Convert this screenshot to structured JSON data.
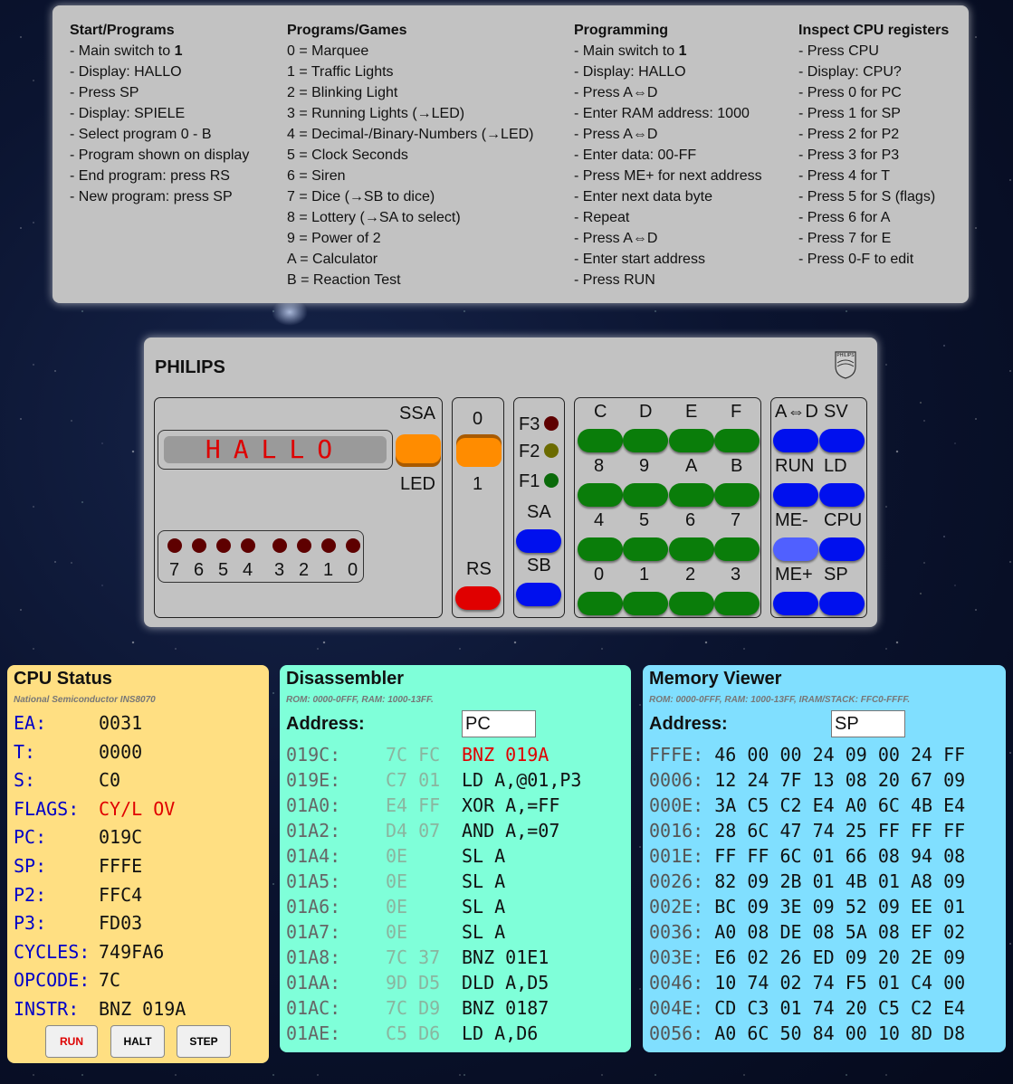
{
  "help": {
    "c1": {
      "title": "Start/Programs",
      "items": [
        "- Main switch to ",
        "- Display: HALLO",
        "- Press SP",
        "- Display: SPIELE",
        "- Select program 0 - B",
        "- Program shown on display",
        "- End program: press RS",
        "- New program: press SP"
      ],
      "bold1": "1"
    },
    "c2": {
      "title": "Programs/Games",
      "items": [
        "0 = Marquee",
        "1 = Traffic Lights",
        "2 = Blinking Light",
        "3 = Running Lights (→LED)",
        "4 = Decimal-/Binary-Numbers (→LED)",
        "5 = Clock Seconds",
        "6 = Siren",
        "7 = Dice (→SB to dice)",
        "8 = Lottery (→SA to select)",
        "9 = Power of 2",
        "A = Calculator",
        "B = Reaction Test"
      ]
    },
    "c3": {
      "title": "Programming",
      "items": [
        "- Main switch to ",
        "- Display: HALLO",
        "- Press A⇔D",
        "- Enter RAM address: 1000",
        "- Press A⇔D",
        "- Enter data: 00-FF",
        "- Press ME+ for next address",
        "- Enter next data byte",
        "- Repeat",
        "- Press A⇔D",
        "- Enter start address",
        "- Press RUN"
      ],
      "bold1": "1"
    },
    "c4": {
      "title": "Inspect CPU registers",
      "items": [
        "- Press CPU",
        "- Display: CPU?",
        "- Press 0 for PC",
        "- Press 1 for SP",
        "- Press 2 for P2",
        "- Press 3 for P3",
        "- Press 4 for T",
        "- Press 5 for S (flags)",
        "- Press 6 for A",
        "- Press 7 for E",
        "- Press 0-F to edit"
      ]
    }
  },
  "device": {
    "brand": "PHILIPS",
    "logo_text": "PHILIPS",
    "display": "HALLO",
    "ssa": "SSA",
    "led": "LED",
    "leds": [
      "7",
      "6",
      "5",
      "4",
      "3",
      "2",
      "1",
      "0"
    ],
    "switch_top": "0",
    "switch_bottom": "1",
    "rs": "RS",
    "f3": "F3",
    "f2": "F2",
    "f1": "F1",
    "sa": "SA",
    "sb": "SB",
    "hex_rows": [
      [
        "C",
        "D",
        "E",
        "F"
      ],
      [
        "8",
        "9",
        "A",
        "B"
      ],
      [
        "4",
        "5",
        "6",
        "7"
      ],
      [
        "0",
        "1",
        "2",
        "3"
      ]
    ],
    "fn": [
      [
        "A⇔D",
        "SV"
      ],
      [
        "RUN",
        "LD"
      ],
      [
        "ME-",
        "CPU"
      ],
      [
        "ME+",
        "SP"
      ]
    ],
    "colors": {
      "f3": "#5e0000",
      "f2": "#6b6b00",
      "f1": "#0a6a0a"
    }
  },
  "cpu": {
    "title": "CPU Status",
    "subtitle": "National Semiconductor INS8070",
    "regs": [
      {
        "name": "EA:",
        "value": "0031"
      },
      {
        "name": "T:",
        "value": "0000"
      },
      {
        "name": "S:",
        "value": "C0"
      },
      {
        "name": "FLAGS:",
        "value": "CY/L OV"
      },
      {
        "name": "PC:",
        "value": "019C"
      },
      {
        "name": "SP:",
        "value": "FFFE"
      },
      {
        "name": "P2:",
        "value": "FFC4"
      },
      {
        "name": "P3:",
        "value": "FD03"
      },
      {
        "name": "CYCLES:",
        "value": "749FA6"
      },
      {
        "name": "OPCODE:",
        "value": "7C"
      },
      {
        "name": "INSTR:",
        "value": "BNZ 019A"
      }
    ],
    "run": "RUN",
    "halt": "HALT",
    "step": "STEP"
  },
  "disasm": {
    "title": "Disassembler",
    "subtitle": "ROM: 0000-0FFF, RAM: 1000-13FF.",
    "address_label": "Address:",
    "address_value": "PC",
    "rows": [
      {
        "a": "019C:",
        "b": "7C FC",
        "i": "BNZ 019A"
      },
      {
        "a": "019E:",
        "b": "C7 01",
        "i": "LD A,@01,P3"
      },
      {
        "a": "01A0:",
        "b": "E4 FF",
        "i": "XOR A,=FF"
      },
      {
        "a": "01A2:",
        "b": "D4 07",
        "i": "AND A,=07"
      },
      {
        "a": "01A4:",
        "b": "0E",
        "i": "SL A"
      },
      {
        "a": "01A5:",
        "b": "0E",
        "i": "SL A"
      },
      {
        "a": "01A6:",
        "b": "0E",
        "i": "SL A"
      },
      {
        "a": "01A7:",
        "b": "0E",
        "i": "SL A"
      },
      {
        "a": "01A8:",
        "b": "7C 37",
        "i": "BNZ 01E1"
      },
      {
        "a": "01AA:",
        "b": "9D D5",
        "i": "DLD A,D5"
      },
      {
        "a": "01AC:",
        "b": "7C D9",
        "i": "BNZ 0187"
      },
      {
        "a": "01AE:",
        "b": "C5 D6",
        "i": "LD A,D6"
      }
    ]
  },
  "mem": {
    "title": "Memory Viewer",
    "subtitle": "ROM: 0000-0FFF, RAM: 1000-13FF, IRAM/STACK: FFC0-FFFF.",
    "address_label": "Address:",
    "address_value": "SP",
    "rows": [
      {
        "a": "FFFE:",
        "b": "46 00 00 24 09 00 24 FF"
      },
      {
        "a": "0006:",
        "b": "12 24 7F 13 08 20 67 09"
      },
      {
        "a": "000E:",
        "b": "3A C5 C2 E4 A0 6C 4B E4"
      },
      {
        "a": "0016:",
        "b": "28 6C 47 74 25 FF FF FF"
      },
      {
        "a": "001E:",
        "b": "FF FF 6C 01 66 08 94 08"
      },
      {
        "a": "0026:",
        "b": "82 09 2B 01 4B 01 A8 09"
      },
      {
        "a": "002E:",
        "b": "BC 09 3E 09 52 09 EE 01"
      },
      {
        "a": "0036:",
        "b": "A0 08 DE 08 5A 08 EF 02"
      },
      {
        "a": "003E:",
        "b": "E6 02 26 ED 09 20 2E 09"
      },
      {
        "a": "0046:",
        "b": "10 74 02 74 F5 01 C4 00"
      },
      {
        "a": "004E:",
        "b": "CD C3 01 74 20 C5 C2 E4"
      },
      {
        "a": "0056:",
        "b": "A0 6C 50 84 00 10 8D D8"
      }
    ]
  }
}
